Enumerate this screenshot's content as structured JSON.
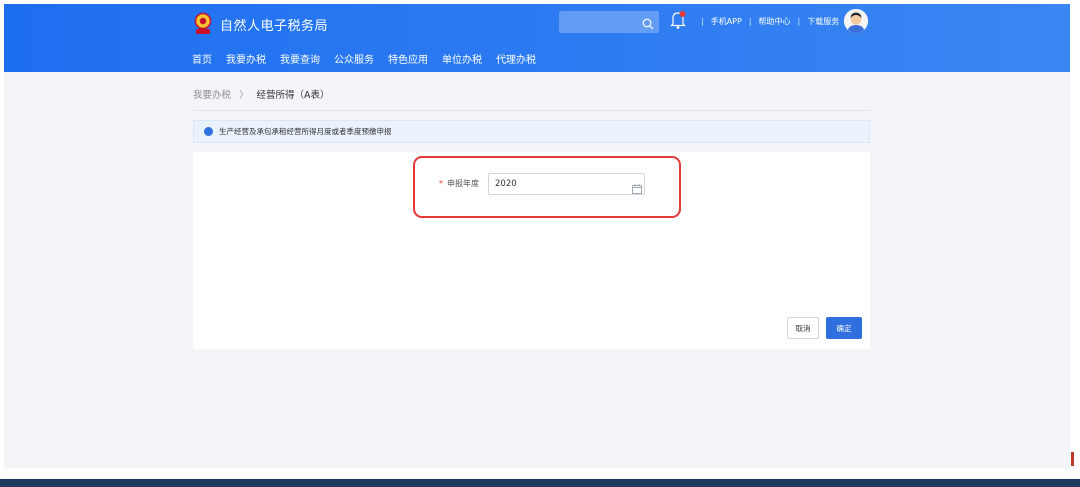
{
  "header": {
    "site_title": "自然人电子税务局",
    "nav": [
      "首页",
      "我要办税",
      "我要查询",
      "公众服务",
      "特色应用",
      "单位办税",
      "代理办税"
    ],
    "search_placeholder": "",
    "top_links": [
      "手机APP",
      "帮助中心",
      "下载服务"
    ]
  },
  "breadcrumb": {
    "parent": "我要办税",
    "separator": "〉",
    "current": "经营所得（A表）"
  },
  "notice": {
    "text": "生产经营及承包承租经营所得月度或者季度预缴申报"
  },
  "form": {
    "required_mark": "*",
    "year_label": "申报年度",
    "year_value": "2020"
  },
  "actions": {
    "cancel_label": "取消",
    "confirm_label": "确定"
  },
  "colors": {
    "header_blue": "#1e6ef0",
    "primary_button": "#2f6fdf",
    "highlight_red": "#e53935",
    "notice_bg": "#eaf2fc"
  }
}
